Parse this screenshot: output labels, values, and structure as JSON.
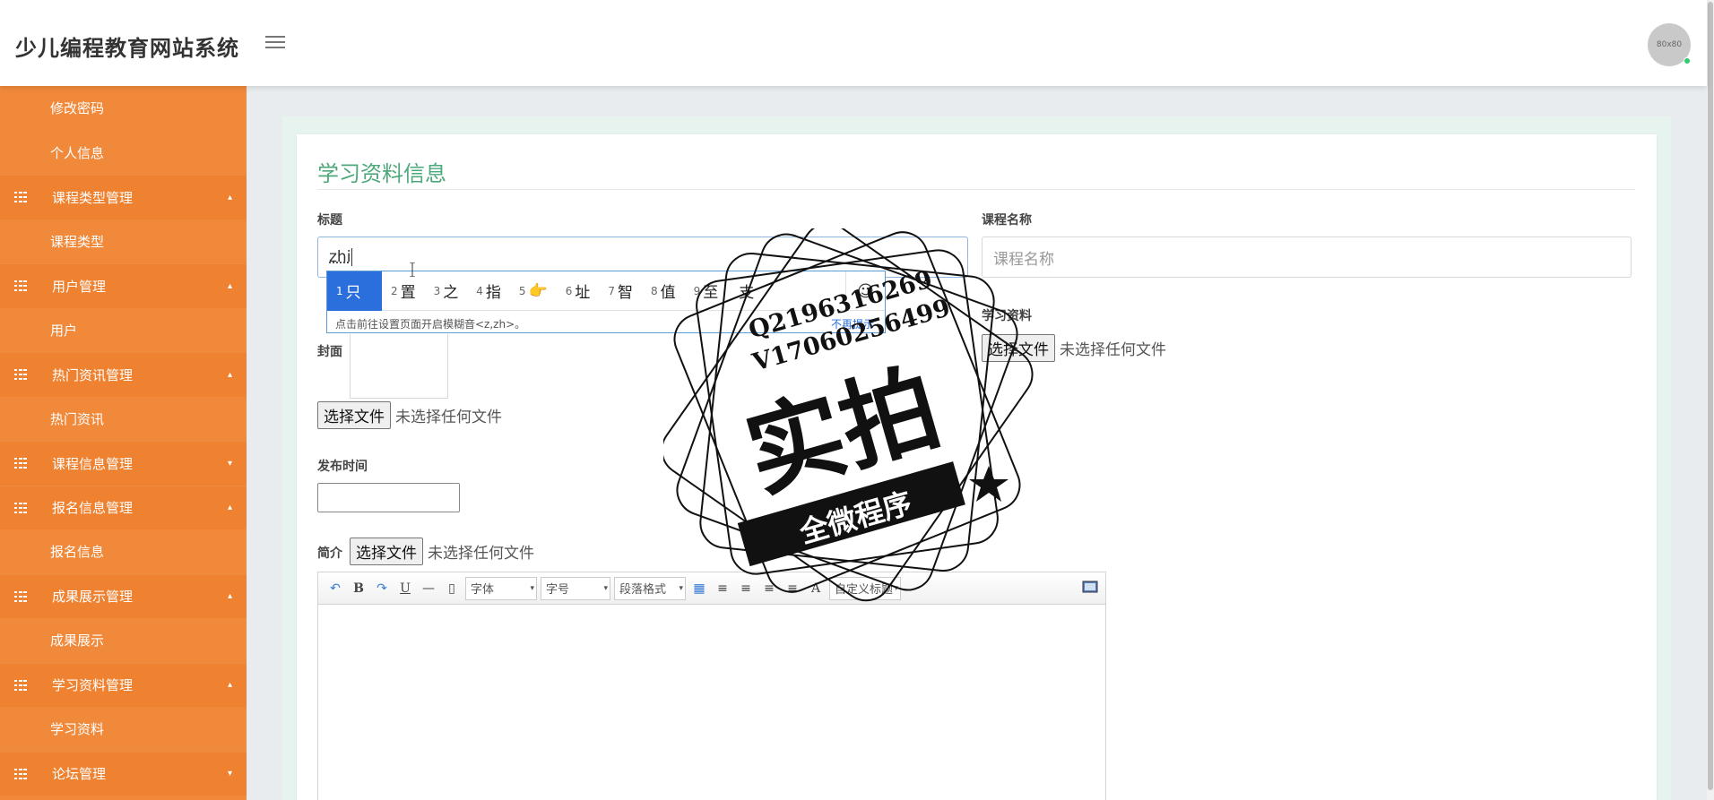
{
  "header": {
    "brand": "少儿编程教育网站系统",
    "avatar_text": "80x80"
  },
  "sidebar": {
    "items": [
      {
        "type": "sub",
        "label": "修改密码"
      },
      {
        "type": "sub",
        "label": "个人信息"
      },
      {
        "type": "group",
        "label": "课程类型管理",
        "chevron": "▴"
      },
      {
        "type": "sub",
        "label": "课程类型"
      },
      {
        "type": "group",
        "label": "用户管理",
        "chevron": "▴"
      },
      {
        "type": "sub",
        "label": "用户"
      },
      {
        "type": "group",
        "label": "热门资讯管理",
        "chevron": "▴"
      },
      {
        "type": "sub",
        "label": "热门资讯"
      },
      {
        "type": "group",
        "label": "课程信息管理",
        "chevron": "▾"
      },
      {
        "type": "group",
        "label": "报名信息管理",
        "chevron": "▴"
      },
      {
        "type": "sub",
        "label": "报名信息"
      },
      {
        "type": "group",
        "label": "成果展示管理",
        "chevron": "▴"
      },
      {
        "type": "sub",
        "label": "成果展示"
      },
      {
        "type": "group",
        "label": "学习资料管理",
        "chevron": "▴"
      },
      {
        "type": "sub",
        "label": "学习资料"
      },
      {
        "type": "group",
        "label": "论坛管理",
        "chevron": "▾"
      }
    ]
  },
  "form": {
    "card_title": "学习资料信息",
    "title_label": "标题",
    "title_value": "zhi",
    "course_label": "课程名称",
    "course_placeholder": "课程名称",
    "material_label": "学习资料",
    "cover_label": "封面",
    "publish_label": "发布时间",
    "intro_label": "简介",
    "file_button": "选择文件",
    "no_file": "未选择任何文件"
  },
  "ime": {
    "candidates": [
      {
        "n": "1",
        "c": "只"
      },
      {
        "n": "2",
        "c": "置"
      },
      {
        "n": "3",
        "c": "之"
      },
      {
        "n": "4",
        "c": "指"
      },
      {
        "n": "5",
        "c": "👉"
      },
      {
        "n": "6",
        "c": "址"
      },
      {
        "n": "7",
        "c": "智"
      },
      {
        "n": "8",
        "c": "值"
      },
      {
        "n": "9",
        "c": "至"
      },
      {
        "n": "",
        "c": "支"
      }
    ],
    "hint": "点击前往设置页面开启模糊音<z,zh>。",
    "dismiss": "不再提示"
  },
  "editor": {
    "font_select": "字体",
    "size_select": "字号",
    "para_select": "段落格式",
    "heading_select": "自定义标题"
  },
  "stamp": {
    "line1": "Q2196316269",
    "line2": "V17060256499",
    "main": "实拍",
    "banner": "全微程序"
  }
}
